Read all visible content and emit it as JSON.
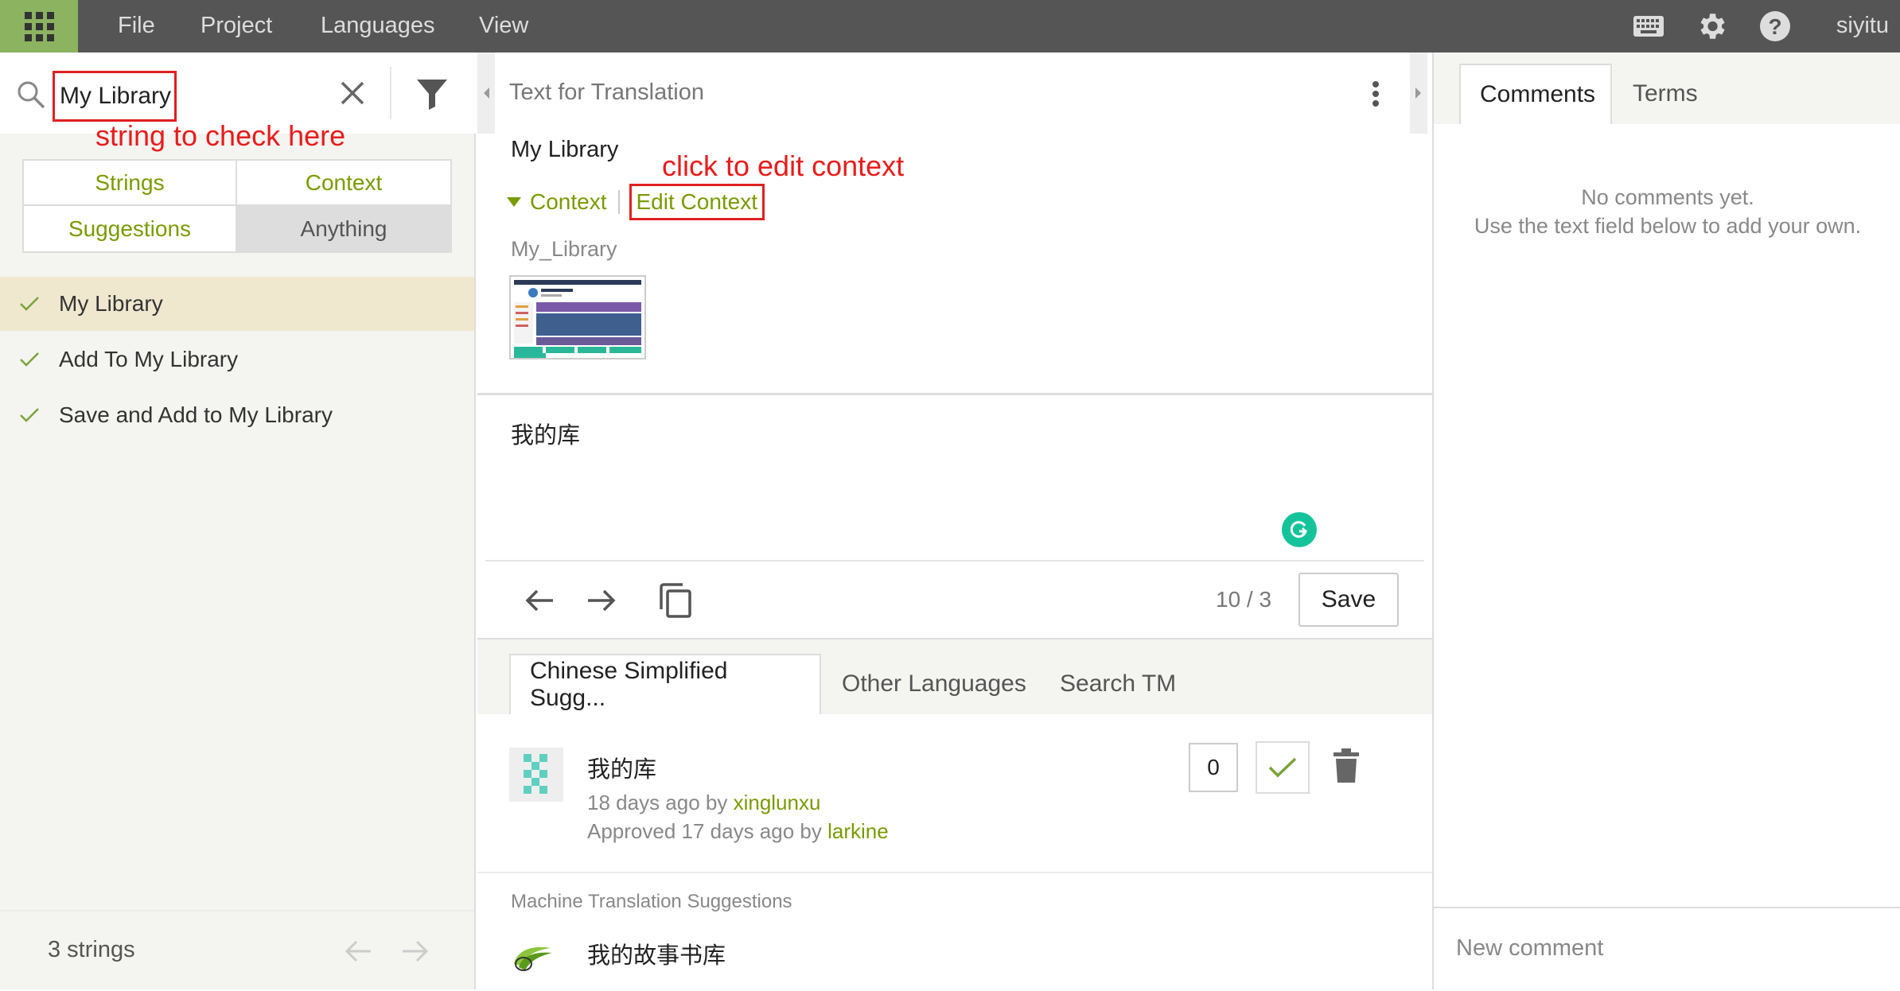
{
  "topbar": {
    "menus": [
      "File",
      "Project",
      "Languages",
      "View"
    ],
    "user": "siyitu"
  },
  "left": {
    "search_value": "My Library",
    "annotation": "string to check here",
    "filters": [
      "Strings",
      "Context",
      "Suggestions",
      "Anything"
    ],
    "active_filter": "Anything",
    "strings": [
      "My Library",
      "Add To My Library",
      "Save and Add to My Library"
    ],
    "selected_index": 0,
    "count": "3 strings"
  },
  "middle": {
    "title": "Text for Translation",
    "source": "My Library",
    "annotation": "click to edit context",
    "context_label": "Context",
    "edit_context_label": "Edit Context",
    "context_key": "My_Library",
    "translation": "我的库",
    "counter": "10 / 3",
    "save_label": "Save",
    "tabs": [
      "Chinese Simplified Sugg...",
      "Other Languages",
      "Search TM"
    ],
    "suggestion": {
      "text": "我的库",
      "time": "18 days ago by ",
      "author": "xinglunxu",
      "approved": "Approved 17 days ago by ",
      "approver": "larkine",
      "votes": "0"
    },
    "mt_title": "Machine Translation Suggestions",
    "mt_text": "我的故事书库"
  },
  "right": {
    "tabs": [
      "Comments",
      "Terms"
    ],
    "no_comments_1": "No comments yet.",
    "no_comments_2": "Use the text field below to add your own.",
    "new_comment_placeholder": "New comment"
  },
  "colors": {
    "accent": "#7a9a01",
    "topbar": "#555555",
    "apps": "#8cb360",
    "annotation": "#e81c1c",
    "selected_row": "#efe8cf"
  }
}
